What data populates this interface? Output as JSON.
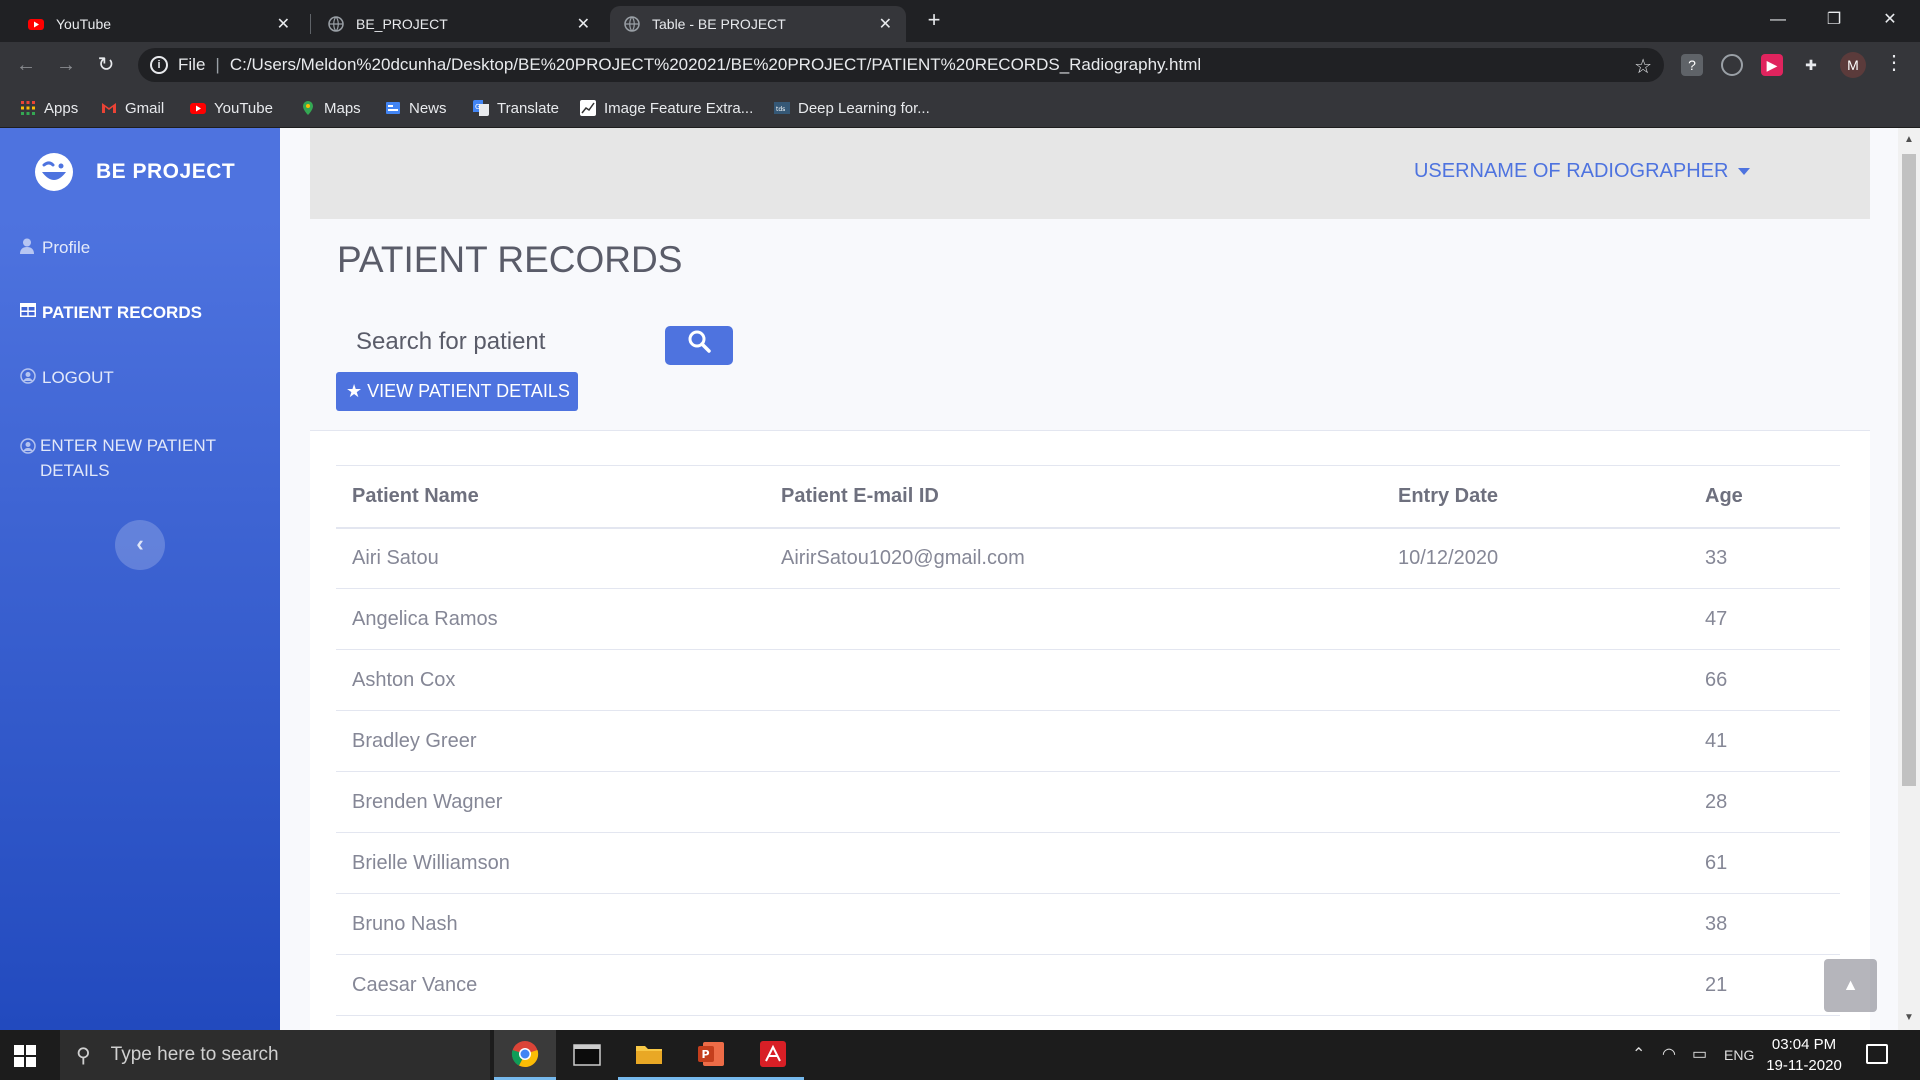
{
  "browser": {
    "tabs": [
      {
        "title": "YouTube",
        "icon": "youtube-icon",
        "active": false
      },
      {
        "title": "BE_PROJECT",
        "icon": "globe-icon",
        "active": false
      },
      {
        "title": "Table - BE PROJECT",
        "icon": "globe-icon",
        "active": true
      }
    ],
    "url_scheme": "File",
    "url": "C:/Users/Meldon%20dcunha/Desktop/BE%20PROJECT%202021/BE%20PROJECT/PATIENT%20RECORDS_Radiography.html",
    "profile_initial": "M",
    "bookmarks": [
      {
        "label": "Apps",
        "icon": "apps-grid-icon"
      },
      {
        "label": "Gmail",
        "icon": "gmail-icon"
      },
      {
        "label": "YouTube",
        "icon": "youtube-icon"
      },
      {
        "label": "Maps",
        "icon": "maps-pin-icon"
      },
      {
        "label": "News",
        "icon": "news-icon"
      },
      {
        "label": "Translate",
        "icon": "translate-icon"
      },
      {
        "label": "Image Feature Extra...",
        "icon": "chart-icon"
      },
      {
        "label": "Deep Learning for...",
        "icon": "tds-icon"
      }
    ]
  },
  "sidebar": {
    "brand": "BE PROJECT",
    "items": [
      {
        "label": "Profile",
        "icon": "user-icon",
        "active": false
      },
      {
        "label": "PATIENT RECORDS",
        "icon": "table-icon",
        "active": true
      },
      {
        "label": "LOGOUT",
        "icon": "user-circle-icon",
        "active": false
      },
      {
        "label": "ENTER NEW PATIENT DETAILS",
        "icon": "user-circle-icon",
        "active": false
      }
    ]
  },
  "topbar": {
    "username": "USERNAME OF RADIOGRAPHER"
  },
  "main": {
    "title": "PATIENT RECORDS",
    "search_placeholder": "Search for patient",
    "view_button": "VIEW PATIENT DETAILS",
    "table": {
      "headers": [
        "Patient Name",
        "Patient E-mail ID",
        "Entry Date",
        "Age"
      ],
      "rows": [
        [
          "Airi Satou",
          "AirirSatou1020@gmail.com",
          "10/12/2020",
          "33"
        ],
        [
          "Angelica Ramos",
          "",
          "",
          "47"
        ],
        [
          "Ashton Cox",
          "",
          "",
          "66"
        ],
        [
          "Bradley Greer",
          "",
          "",
          "41"
        ],
        [
          "Brenden Wagner",
          "",
          "",
          "28"
        ],
        [
          "Brielle Williamson",
          "",
          "",
          "61"
        ],
        [
          "Bruno Nash",
          "",
          "",
          "38"
        ],
        [
          "Caesar Vance",
          "",
          "",
          "21"
        ]
      ]
    }
  },
  "taskbar": {
    "search_placeholder": "Type here to search",
    "language": "ENG",
    "time": "03:04 PM",
    "date": "19-11-2020"
  },
  "colors": {
    "primary": "#4e73df",
    "sidebar_gradient_end": "#224abe",
    "chrome_dark": "#202124"
  }
}
